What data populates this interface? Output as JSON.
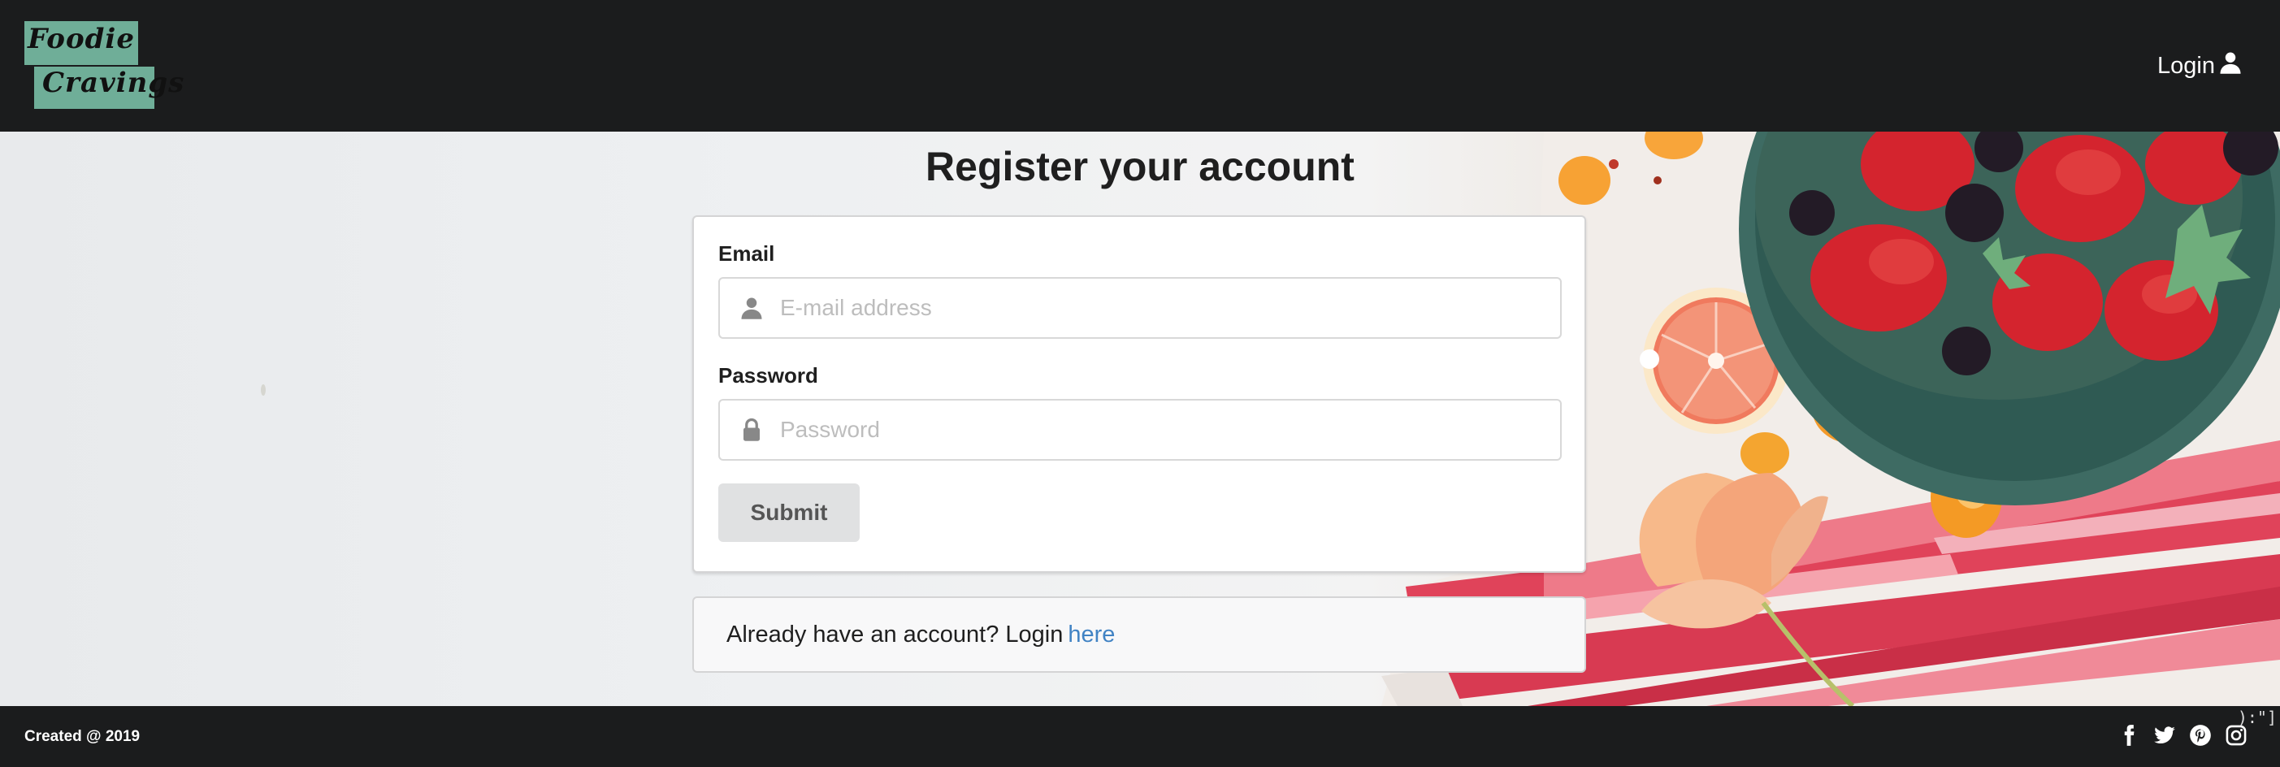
{
  "header": {
    "logo_line1": "Foodie",
    "logo_line2": "Cravings",
    "login_label": "Login",
    "login_icon": "user-icon"
  },
  "main": {
    "title": "Register your account",
    "email": {
      "label": "Email",
      "placeholder": "E-mail address",
      "icon": "user-icon"
    },
    "password": {
      "label": "Password",
      "placeholder": "Password",
      "icon": "lock-icon"
    },
    "submit_label": "Submit",
    "login_prompt": "Already have an account? Login",
    "login_link": "here"
  },
  "footer": {
    "copyright": "Created @ 2019",
    "socials": [
      "facebook-icon",
      "twitter-icon",
      "pinterest-icon",
      "instagram-icon"
    ],
    "corner_text": "):\"]"
  },
  "colors": {
    "header_bg": "#1b1c1d",
    "logo_bg": "#6fae98",
    "link": "#4183c4",
    "button_bg": "#e0e1e2"
  }
}
